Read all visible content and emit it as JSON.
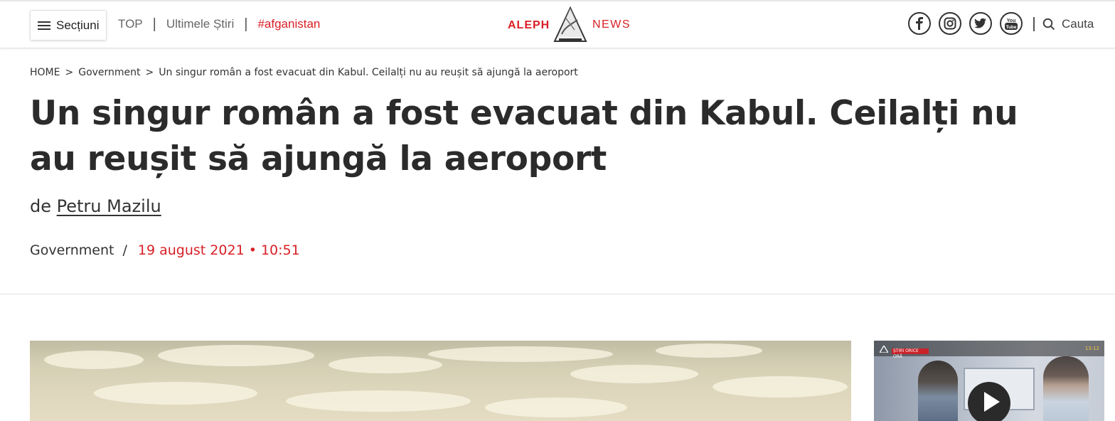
{
  "header": {
    "sections_label": "Secțiuni",
    "nav": [
      {
        "label": "TOP"
      },
      {
        "label": "Ultimele Știri"
      },
      {
        "label": "#afganistan"
      }
    ],
    "separator": "|",
    "logo": {
      "left": "ALEPH",
      "right": "NEWS"
    },
    "social": [
      "facebook-icon",
      "instagram-icon",
      "twitter-icon",
      "youtube-icon"
    ],
    "search_label": "Cauta"
  },
  "breadcrumb": {
    "items": [
      "HOME",
      "Government",
      "Un singur român a fost evacuat din Kabul. Ceilalți nu au reușit să ajungă la aeroport"
    ],
    "separator": ">"
  },
  "article": {
    "title": "Un singur român a fost evacuat din Kabul. Ceilalți nu au reușit să ajungă la aeroport",
    "byline_prefix": "de",
    "author": "Petru Mazilu",
    "category": "Government",
    "meta_separator": "/",
    "date": "19 august 2021 • 10:51"
  },
  "video": {
    "tag": "ȘTIRI ORICE ORĂ",
    "time": "13:12"
  },
  "colors": {
    "accent": "#d81f26",
    "text": "#333333"
  }
}
